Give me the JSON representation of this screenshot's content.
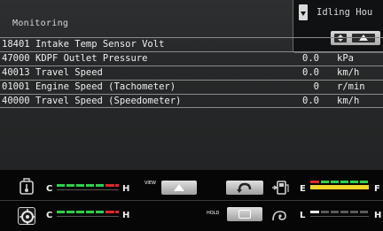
{
  "screen": {
    "title": "Monitoring",
    "overlay": {
      "text": "Idling Hou"
    },
    "rows": [
      {
        "code": "18401",
        "name": "Intake Temp Sensor Volt",
        "value": "",
        "unit": ""
      },
      {
        "code": "47000",
        "name": "KDPF Outlet Pressure",
        "value": "0.0",
        "unit": "kPa"
      },
      {
        "code": "40013",
        "name": "Travel Speed",
        "value": "0.0",
        "unit": "km/h"
      },
      {
        "code": "01001",
        "name": "Engine Speed (Tachometer)",
        "value": "0",
        "unit": "r/min"
      },
      {
        "code": "40000",
        "name": "Travel Speed (Speedometer)",
        "value": "0.0",
        "unit": "km/h"
      }
    ]
  },
  "status": {
    "gauge1": {
      "left_label": "C",
      "right_label": "H"
    },
    "gauge2": {
      "left_label": "C",
      "right_label": "H"
    },
    "fuel": {
      "left_label": "E",
      "right_label": "F"
    },
    "gauge4": {
      "left_label": "L",
      "right_label": "H"
    },
    "buttons": {
      "hold_label": "HOLD",
      "view_label": "VIEW"
    }
  },
  "colors": {
    "green": "#2ecf4a",
    "red": "#e02828",
    "yellow": "#f1d628",
    "white": "#ffffff"
  }
}
